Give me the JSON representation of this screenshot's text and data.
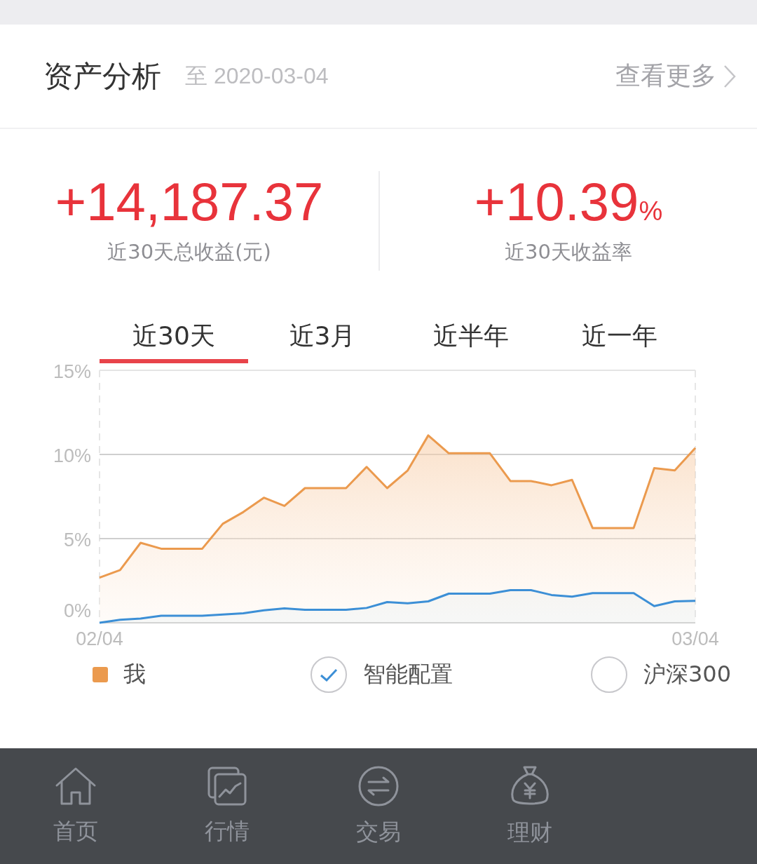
{
  "header": {
    "title": "资产分析",
    "date": "至 2020-03-04",
    "more_link": "查看更多"
  },
  "stats": [
    {
      "value": "+14,187.37",
      "label": "近30天总收益(元)"
    },
    {
      "value": "+10.39",
      "unit": "%",
      "label": "近30天收益率"
    }
  ],
  "tabs": [
    {
      "label": "近30天",
      "selected": true
    },
    {
      "label": "近3月",
      "selected": false
    },
    {
      "label": "近半年",
      "selected": false
    },
    {
      "label": "近一年",
      "selected": false
    }
  ],
  "chart_data": {
    "type": "area",
    "categories": [
      "02/04",
      null,
      null,
      null,
      null,
      null,
      null,
      null,
      null,
      null,
      null,
      null,
      null,
      null,
      null,
      null,
      null,
      null,
      null,
      null,
      null,
      null,
      null,
      null,
      null,
      null,
      null,
      null,
      null,
      "03/04"
    ],
    "ylim": [
      0,
      15
    ],
    "yticks": [
      {
        "value": 0,
        "label": "0%"
      },
      {
        "value": 5,
        "label": "5%"
      },
      {
        "value": 10,
        "label": "10%"
      },
      {
        "value": 15,
        "label": "15%"
      }
    ],
    "series": [
      {
        "color": "#eb9a4e",
        "values": [
          2.68,
          3.13,
          4.75,
          4.4,
          4.4,
          4.4,
          5.88,
          6.58,
          7.43,
          6.94,
          8.0,
          8.0,
          8.0,
          9.26,
          8.0,
          9.05,
          11.13,
          10.07,
          10.07,
          10.07,
          8.42,
          8.42,
          8.17,
          8.49,
          5.63,
          5.63,
          5.63,
          9.19,
          9.05,
          10.39
        ]
      },
      {
        "color": "#3c8fd6",
        "values": [
          0,
          0.18,
          0.25,
          0.42,
          0.42,
          0.42,
          0.49,
          0.56,
          0.74,
          0.85,
          0.77,
          0.77,
          0.77,
          0.88,
          1.23,
          1.16,
          1.27,
          1.73,
          1.73,
          1.73,
          1.94,
          1.94,
          1.65,
          1.55,
          1.76,
          1.76,
          1.76,
          0.99,
          1.27,
          1.3
        ]
      }
    ]
  },
  "legend": [
    {
      "kind": "square",
      "label": "我",
      "color": "#eb9a4e"
    },
    {
      "kind": "check",
      "label": "智能配置",
      "checked": true
    },
    {
      "kind": "check",
      "label": "沪深300",
      "checked": false
    }
  ],
  "bottom_nav": [
    {
      "kind": "home",
      "label": "首页"
    },
    {
      "kind": "market",
      "label": "行情"
    },
    {
      "kind": "trade",
      "label": "交易"
    },
    {
      "kind": "wealth",
      "label": "理财"
    }
  ]
}
